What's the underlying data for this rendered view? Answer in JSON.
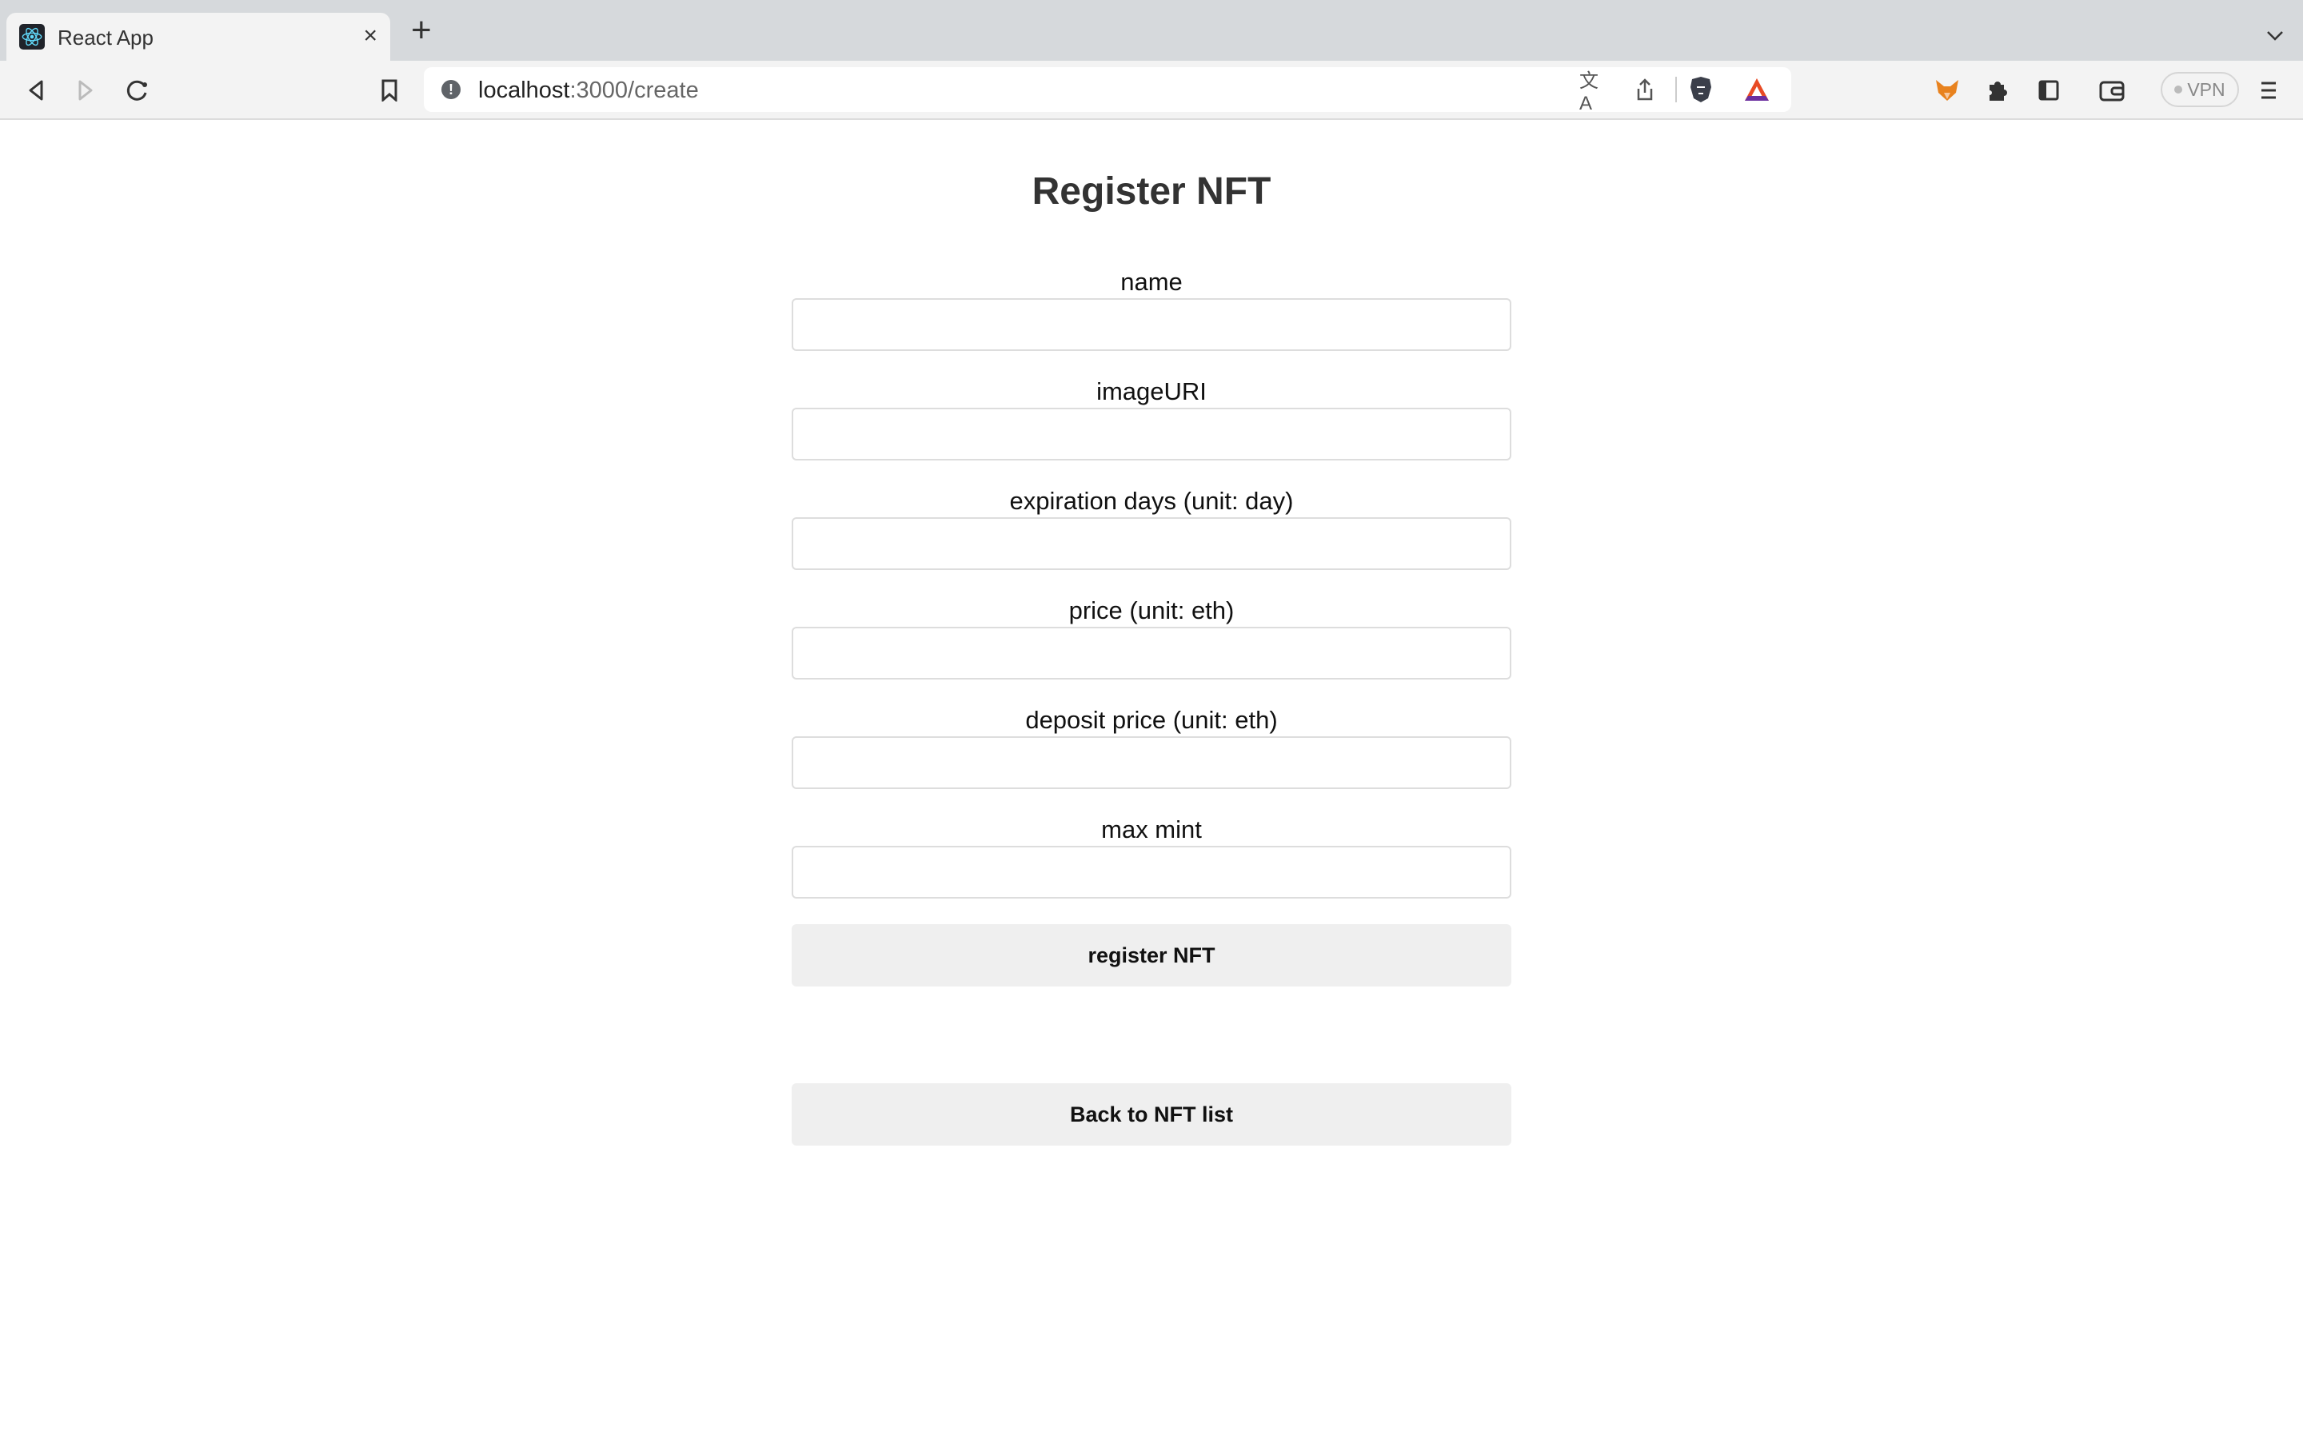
{
  "browser": {
    "tab_title": "React App",
    "tab_close": "×",
    "new_tab": "+",
    "tab_menu": "⌄",
    "url_host": "localhost",
    "url_rest": ":3000/create",
    "vpn_label": "VPN"
  },
  "page": {
    "title": "Register NFT",
    "fields": [
      {
        "label": "name",
        "value": ""
      },
      {
        "label": "imageURI",
        "value": ""
      },
      {
        "label": "expiration days (unit: day)",
        "value": ""
      },
      {
        "label": "price (unit: eth)",
        "value": ""
      },
      {
        "label": "deposit price (unit: eth)",
        "value": ""
      },
      {
        "label": "max mint",
        "value": ""
      }
    ],
    "register_button": "register NFT",
    "back_button": "Back to NFT list"
  }
}
